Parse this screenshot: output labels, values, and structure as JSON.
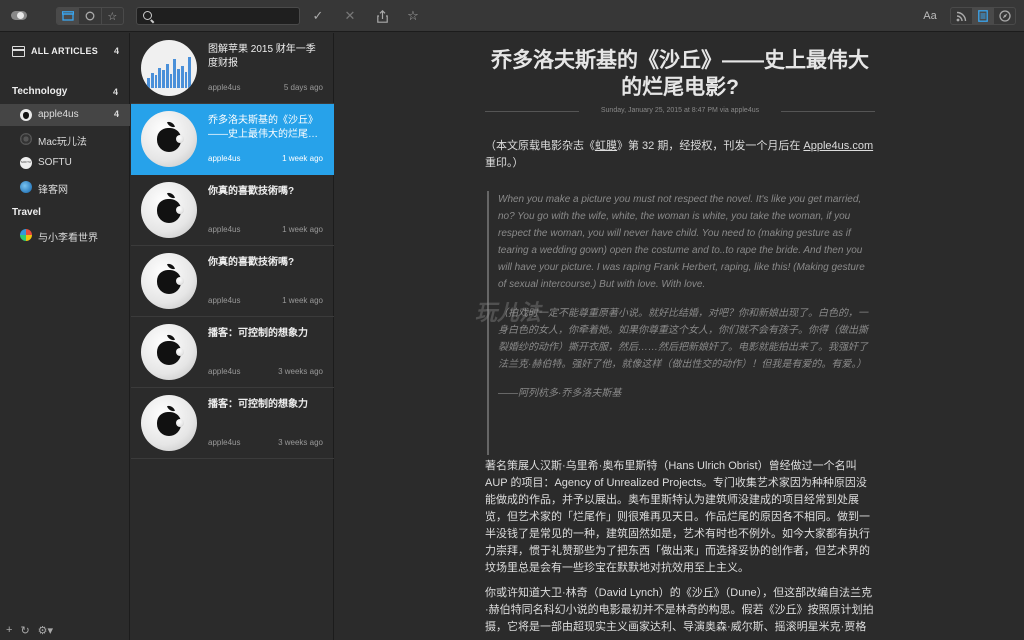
{
  "toolbar": {
    "search_value": "",
    "font_label": "Aa"
  },
  "sidebar": {
    "all_label": "ALL ARTICLES",
    "all_count": "4",
    "groups": [
      {
        "label": "Technology",
        "count": "4"
      },
      {
        "label": "Travel"
      }
    ],
    "feeds": [
      {
        "label": "apple4us",
        "count": "4",
        "icon": "apple-icon"
      },
      {
        "label": "Mac玩儿法",
        "icon": "mac-wanerfa-icon"
      },
      {
        "label": "SOFTU",
        "icon": "softu-icon"
      },
      {
        "label": "锋客网",
        "icon": "fengke-icon"
      },
      {
        "label": "与小李看世界",
        "icon": "world-icon"
      }
    ]
  },
  "articles": [
    {
      "title": "图解苹果 2015 财年一季度财报",
      "source": "apple4us",
      "time": "5 days ago"
    },
    {
      "title": "乔多洛夫斯基的《沙丘》——史上最伟大的烂尾…",
      "source": "apple4us",
      "time": "1 week ago"
    },
    {
      "title": "你真的喜歡技術嗎?",
      "source": "apple4us",
      "time": "1 week ago"
    },
    {
      "title": "你真的喜歡技術嗎?",
      "source": "apple4us",
      "time": "1 week ago"
    },
    {
      "title": "播客：可控制的想象力",
      "source": "apple4us",
      "time": "3 weeks ago"
    },
    {
      "title": "播客：可控制的想象力",
      "source": "apple4us",
      "time": "3 weeks ago"
    }
  ],
  "reader": {
    "title": "乔多洛夫斯基的《沙丘》——史上最伟大的烂尾电影?",
    "meta": "Sunday, January 25, 2015 at 8:47 PM via apple4us",
    "intro_a": "（本文原载电影杂志《",
    "intro_link1": "虹膜",
    "intro_b": "》第 32 期，经授权，刊发一个月后在 ",
    "intro_link2": "Apple4us.com",
    "intro_c": " 重印。）",
    "quote_en": "When you make a picture you must not respect the novel. It's like you get married, no? You go with the wife, white, the woman is white, you take the woman, if you respect the woman, you will never have child. You need to (making gesture as if tearing a wedding gown) open the costume and to..to rape the bride. And then you will have your picture. I was raping Frank Herbert, raping, like this! (Making gesture of sexual intercourse.) But with love. With love.",
    "quote_cn": "（拍戏时一定不能尊重原著小说。就好比结婚，对吧？你和新娘出现了。白色的，一身白色的女人，你牵着她。如果你尊重这个女人，你们就不会有孩子。你得（做出撕裂婚纱的动作）撕开衣服，然后……然后把新娘奸了。电影就能拍出来了。我强奸了法兰克·赫伯特。强奸了他，就像这样（做出性交的动作）！但我是有爱的。有爱。）",
    "quote_attr": "——阿列杭多·乔多洛夫斯基",
    "watermark": "玩儿法",
    "para1": "著名策展人汉斯·乌里希·奥布里斯特（Hans Ulrich Obrist）曾经做过一个名叫 AUP 的项目：Agency of Unrealized Projects。专门收集艺术家因为种种原因没能做成的作品，并予以展出。奥布里斯特认为建筑师没建成的项目经常到处展览，但艺术家的「烂尾作」则很难再见天日。作品烂尾的原因各不相同。做到一半没钱了是常见的一种，建筑固然如是，艺术有时也不例外。如今大家都有执行力崇拜，惯于礼赞那些为了把东西「做出来」而选择妥协的创作者，但艺术界的坟场里总是会有一些珍宝在默默地对抗效用至上主义。",
    "para2": "你或许知道大卫·林奇（David Lynch）的《沙丘》（Dune），但这部改编自法兰克·赫伯特同名科幻小说的电影最初并不是林奇的构思。假若《沙丘》按照原计划拍摄，它将是一部由超现实主义画家达利、导演奥森·威尔斯、摇滚明星米克·贾格"
  },
  "colors": {
    "accent": "#27a2ea",
    "toolbar_active": "#3aa6f0"
  }
}
